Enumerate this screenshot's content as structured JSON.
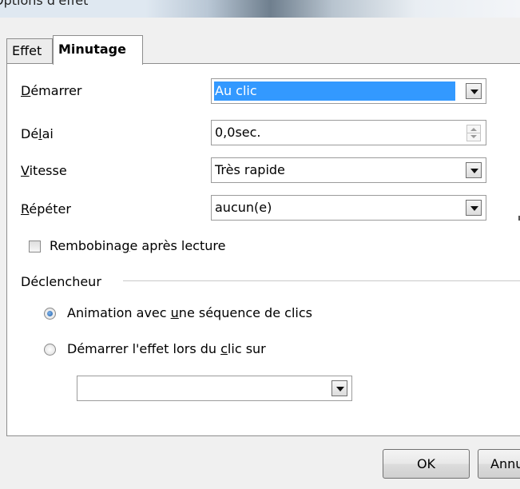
{
  "window": {
    "title": "Options d'effet"
  },
  "tabs": [
    {
      "label": "Effet",
      "active": false
    },
    {
      "label": "Minutage",
      "active": true
    }
  ],
  "fields": {
    "start": {
      "label_pre": "",
      "label_accel": "D",
      "label_post": "émarrer",
      "value": "Au clic"
    },
    "delay": {
      "label_pre": "Dé",
      "label_accel": "l",
      "label_post": "ai",
      "value": "0,0sec."
    },
    "speed": {
      "label_pre": "",
      "label_accel": "V",
      "label_post": "itesse",
      "value": "Très rapide"
    },
    "repeat": {
      "label_pre": "",
      "label_accel": "R",
      "label_post": "épéter",
      "value": "aucun(e)"
    }
  },
  "rewind": {
    "label_pre": "Rembobina",
    "label_accel": "g",
    "label_post": "e après lecture",
    "checked": false
  },
  "trigger": {
    "group_label": "Déclencheur",
    "option1": {
      "label_pre": "Animation avec ",
      "label_accel": "u",
      "label_post": "ne séquence de clics",
      "checked": true
    },
    "option2": {
      "label_pre": "Démarrer l'effet lors du ",
      "label_accel": "c",
      "label_post": "lic sur",
      "checked": false
    },
    "shape_value": ""
  },
  "buttons": {
    "ok": "OK",
    "cancel": "Annuler"
  },
  "colors": {
    "selection": "#3399ff",
    "panel_bg": "#ffffff",
    "dialog_bg": "#f0f0f0"
  }
}
